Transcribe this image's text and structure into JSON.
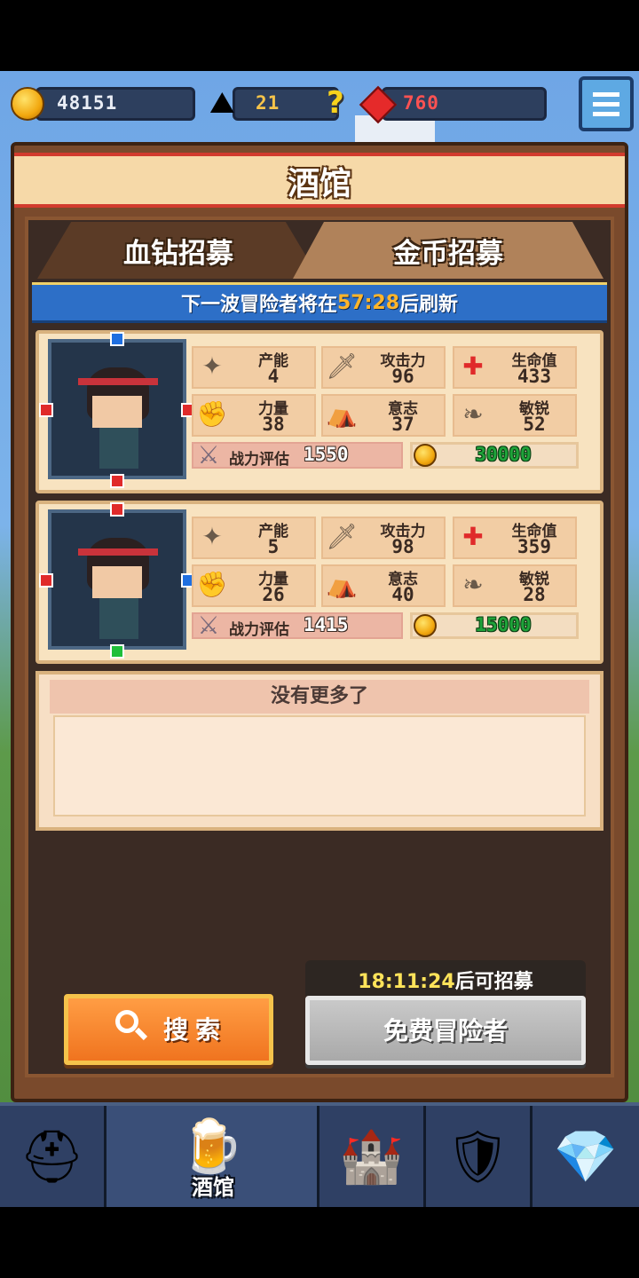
{
  "topbar": {
    "gold": "48151",
    "ore": "21",
    "ore_help": "?",
    "gems": "760",
    "menu_icon": "list-menu-icon"
  },
  "panel": {
    "title": "酒馆",
    "tabs": [
      {
        "label": "血钻招募",
        "active": false
      },
      {
        "label": "金币招募",
        "active": true
      }
    ],
    "refresh": {
      "prefix": "下一波冒险者将在",
      "time": "57:28",
      "suffix": "后刷新"
    }
  },
  "heroes": [
    {
      "stats": [
        {
          "label": "产能",
          "value": "4",
          "icon": "crystal-icon"
        },
        {
          "label": "攻击力",
          "value": "96",
          "icon": "sword-icon"
        },
        {
          "label": "生命值",
          "value": "433",
          "icon": "health-cross-icon"
        },
        {
          "label": "力量",
          "value": "38",
          "icon": "gauntlet-icon"
        },
        {
          "label": "意志",
          "value": "37",
          "icon": "hood-icon"
        },
        {
          "label": "敏锐",
          "value": "52",
          "icon": "wing-icon"
        }
      ],
      "power_label": "战力评估",
      "power": "1550",
      "price": "30000"
    },
    {
      "stats": [
        {
          "label": "产能",
          "value": "5",
          "icon": "crystal-icon"
        },
        {
          "label": "攻击力",
          "value": "98",
          "icon": "sword-icon"
        },
        {
          "label": "生命值",
          "value": "359",
          "icon": "health-cross-icon"
        },
        {
          "label": "力量",
          "value": "26",
          "icon": "gauntlet-icon"
        },
        {
          "label": "意志",
          "value": "40",
          "icon": "hood-icon"
        },
        {
          "label": "敏锐",
          "value": "28",
          "icon": "wing-icon"
        }
      ],
      "power_label": "战力评估",
      "power": "1415",
      "price": "15000"
    }
  ],
  "empty": {
    "text": "没有更多了"
  },
  "actions": {
    "search_label": "搜索",
    "timer_time": "18:11:24",
    "timer_suffix": "后可招募",
    "free_label": "免费冒险者"
  },
  "nav": {
    "items": [
      "helmet-icon",
      "tavern-mug-icon",
      "castle-icon",
      "guild-shield-icon",
      "gem-coins-icon"
    ],
    "active_label": "酒馆"
  },
  "colors": {
    "accent_red": "#d23b2d",
    "gold_text": "#f6c44a",
    "price_green": "#1fa33a",
    "banner_blue": "#2d6fc7"
  }
}
